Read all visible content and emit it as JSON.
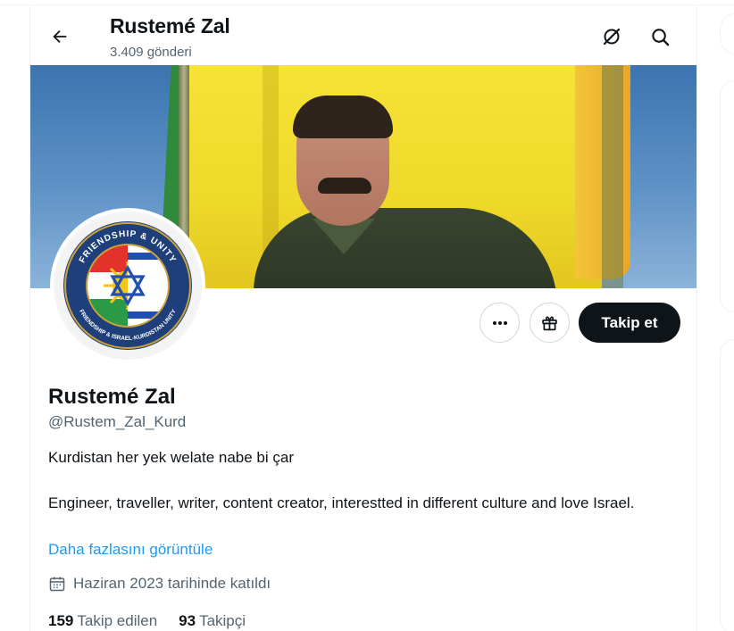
{
  "header": {
    "title": "Rustemé Zal",
    "post_count": "3.409 gönderi",
    "back_icon": "arrow-left-icon",
    "grok_icon": "grok-icon",
    "search_icon": "search-icon"
  },
  "banner": {
    "image": "yellow-flag-portrait-banner"
  },
  "avatar": {
    "badge_top_text": "FRIENDSHIP & UNITY",
    "badge_bottom_text": "FRIENDSHIP & ISRAEL-KURDISTAN UNITY"
  },
  "actions": {
    "more_icon": "more-dots-icon",
    "gift_icon": "gift-icon",
    "follow_label": "Takip et"
  },
  "profile": {
    "name": "Rustemé Zal",
    "handle": "@Rustem_Zal_Kurd",
    "bio_line1": "Kurdistan her yek welate nabe bi çar",
    "bio_line2": "Engineer, traveller, writer, content creator, interestted in different culture and love Israel.",
    "show_more": "Daha fazlasını görüntüle",
    "joined_icon": "calendar-icon",
    "joined": "Haziran 2023 tarihinde katıldı",
    "following_count": "159",
    "following_label": "Takip edilen",
    "followers_count": "93",
    "followers_label": "Takipçi"
  },
  "colors": {
    "accent": "#1d9bf0",
    "text": "#0f1419",
    "muted": "#536471",
    "follow_bg": "#0f1419",
    "border": "#cfd9de"
  }
}
